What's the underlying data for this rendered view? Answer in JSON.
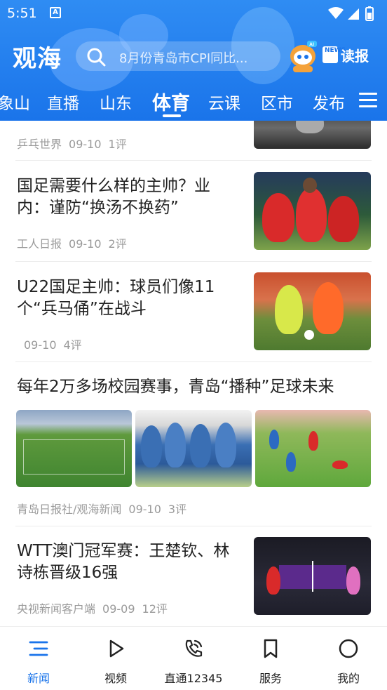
{
  "status_bar": {
    "time": "5:51",
    "notification_glyph": "A"
  },
  "header": {
    "logo": "观海",
    "search_placeholder": "8月份青岛市CPI同比...",
    "dubao_label": "读报",
    "dubao_paper_text": "NEWS"
  },
  "channels": [
    {
      "label": "象山"
    },
    {
      "label": "直播"
    },
    {
      "label": "山东"
    },
    {
      "label": "体育",
      "active": true
    },
    {
      "label": "云课"
    },
    {
      "label": "区市"
    },
    {
      "label": "发布"
    }
  ],
  "articles": [
    {
      "title": "",
      "source": "乒乓世界",
      "date": "09-10",
      "comments": "1评"
    },
    {
      "title": "国足需要什么样的主帅？业内：谨防“换汤不换药”",
      "source": "工人日报",
      "date": "09-10",
      "comments": "2评"
    },
    {
      "title": "U22国足主帅：球员们像11个“兵马俑”在战斗",
      "source": "",
      "date": "09-10",
      "comments": "4评"
    },
    {
      "title": "每年2万多场校园赛事，青岛“播种”足球未来",
      "source": "青岛日报社/观海新闻",
      "date": "09-10",
      "comments": "3评"
    },
    {
      "title": "WTT澳门冠军赛：王楚钦、林诗栋晋级16强",
      "source": "央视新闻客户端",
      "date": "09-09",
      "comments": "12评"
    }
  ],
  "bottom_nav": [
    {
      "label": "新闻",
      "icon": "news-list-icon",
      "active": true
    },
    {
      "label": "视频",
      "icon": "play-icon"
    },
    {
      "label": "直通12345",
      "icon": "phone-icon"
    },
    {
      "label": "服务",
      "icon": "bookmark-icon"
    },
    {
      "label": "我的",
      "icon": "profile-icon"
    }
  ],
  "colors": {
    "brand_blue": "#1a74ea",
    "meta_gray": "#9a9a9a"
  }
}
